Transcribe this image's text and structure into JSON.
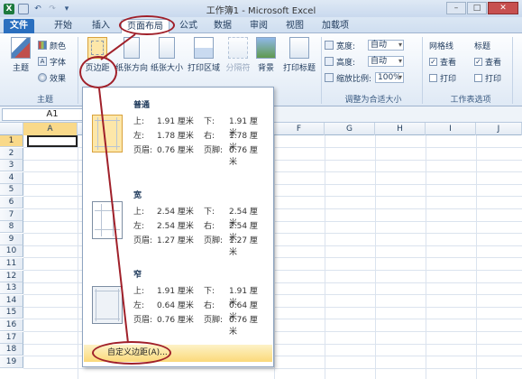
{
  "window": {
    "title": "工作簿1 - Microsoft Excel",
    "app_icon": "X",
    "buttons": [
      "–",
      "□",
      "✕"
    ]
  },
  "tabs": [
    "文件",
    "开始",
    "插入",
    "页面布局",
    "公式",
    "数据",
    "审阅",
    "视图",
    "加载项"
  ],
  "ribbon": {
    "theme": {
      "main_label": "主题",
      "colors": "颜色",
      "fonts": "字体",
      "effects": "效果",
      "group_label": "主题"
    },
    "page_setup": {
      "margins": "页边距",
      "orientation": "纸张方向",
      "size": "纸张大小",
      "print_area": "打印区域",
      "breaks": "分隔符",
      "background": "背景",
      "print_titles": "打印标题"
    },
    "scale": {
      "width_label": "宽度:",
      "width_value": "自动",
      "height_label": "高度:",
      "height_value": "自动",
      "scale_label": "缩放比例:",
      "scale_value": "100%",
      "group_label": "调整为合适大小"
    },
    "sheet_options": {
      "gridlines": "网格线",
      "headings": "标题",
      "view": "查看",
      "print": "打印",
      "group_label": "工作表选项"
    }
  },
  "name_box": "A1",
  "columns": [
    "A",
    "F",
    "G",
    "H",
    "I",
    "J"
  ],
  "rows": [
    "1",
    "2",
    "3",
    "4",
    "5",
    "6",
    "7",
    "8",
    "9",
    "10",
    "11",
    "12",
    "13",
    "14",
    "15",
    "16",
    "17",
    "18",
    "19"
  ],
  "margins_menu": {
    "presets": [
      {
        "name": "普通",
        "rows": [
          [
            "上:",
            "1.91 厘米",
            "下:",
            "1.91 厘米"
          ],
          [
            "左:",
            "1.78 厘米",
            "右:",
            "1.78 厘米"
          ],
          [
            "页眉:",
            "0.76 厘米",
            "页脚:",
            "0.76 厘米"
          ]
        ]
      },
      {
        "name": "宽",
        "rows": [
          [
            "上:",
            "2.54 厘米",
            "下:",
            "2.54 厘米"
          ],
          [
            "左:",
            "2.54 厘米",
            "右:",
            "2.54 厘米"
          ],
          [
            "页眉:",
            "1.27 厘米",
            "页脚:",
            "1.27 厘米"
          ]
        ]
      },
      {
        "name": "窄",
        "rows": [
          [
            "上:",
            "1.91 厘米",
            "下:",
            "1.91 厘米"
          ],
          [
            "左:",
            "0.64 厘米",
            "右:",
            "0.64 厘米"
          ],
          [
            "页眉:",
            "0.76 厘米",
            "页脚:",
            "0.76 厘米"
          ]
        ]
      }
    ],
    "custom": "自定义边距(A)..."
  },
  "colors": {
    "file_tab": "#2a6fbf",
    "annotation": "#a0202a",
    "selection": "#f9d98a"
  }
}
